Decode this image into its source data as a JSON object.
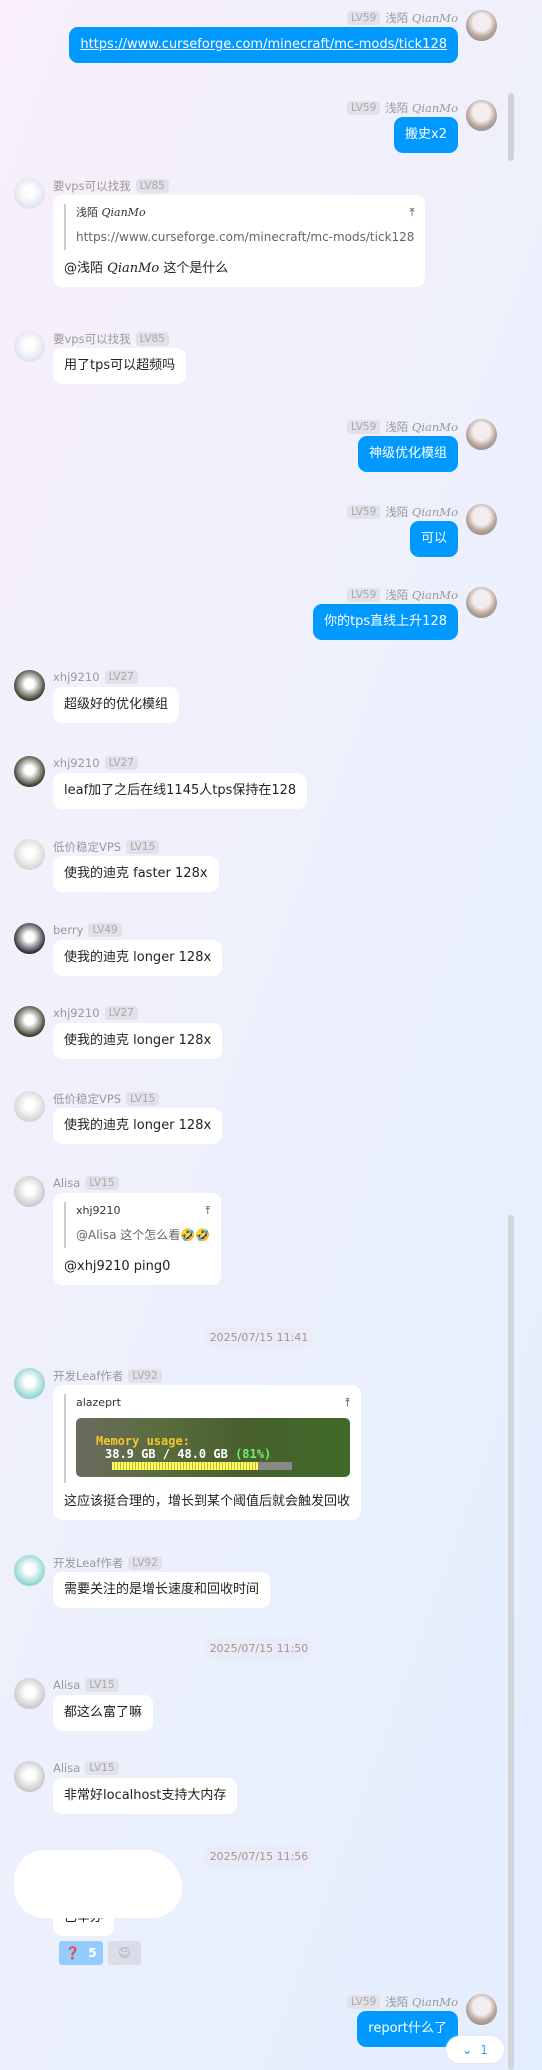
{
  "messages": [
    {
      "side": "self",
      "level": "LV59",
      "name_cn": "浅陌",
      "name_en": "QianMo",
      "text": "https://www.curseforge.com/minecraft/mc-mods/tick128",
      "link": true
    },
    {
      "side": "self",
      "level": "LV59",
      "name_cn": "浅陌",
      "name_en": "QianMo",
      "text": "搬史x2"
    },
    {
      "side": "other",
      "name": "要vps可以找我",
      "level": "LV85",
      "avatar": "#dfe3f0",
      "quote": {
        "name_cn": "浅陌",
        "name_en": "QianMo",
        "text": "https://www.curseforge.com/minecraft/mc-mods/tick128"
      },
      "mention_cn": "@浅陌",
      "mention_en": "QianMo",
      "text": "这个是什么"
    },
    {
      "side": "other",
      "name": "要vps可以找我",
      "level": "LV85",
      "avatar": "#dfe3f0",
      "text": "用了tps可以超频吗"
    },
    {
      "side": "self",
      "level": "LV59",
      "name_cn": "浅陌",
      "name_en": "QianMo",
      "text": "神级优化模组"
    },
    {
      "side": "self",
      "level": "LV59",
      "name_cn": "浅陌",
      "name_en": "QianMo",
      "text": "可以"
    },
    {
      "side": "self",
      "level": "LV59",
      "name_cn": "浅陌",
      "name_en": "QianMo",
      "text": "你的tps直线上升128"
    },
    {
      "side": "other",
      "name": "xhj9210",
      "level": "LV27",
      "avatar": "#3b3d2c",
      "text": "超级好的优化模组"
    },
    {
      "side": "other",
      "name": "xhj9210",
      "level": "LV27",
      "avatar": "#3b3d2c",
      "text": "leaf加了之后在线1145人tps保持在128"
    },
    {
      "side": "other",
      "name": "低价稳定VPS",
      "level": "LV15",
      "avatar": "#d8d4d4",
      "text": "使我的迪克 faster 128x"
    },
    {
      "side": "other",
      "name": "berry",
      "level": "LV49",
      "avatar": "#2b2b33",
      "text": "使我的迪克 longer 128x"
    },
    {
      "side": "other",
      "name": "xhj9210",
      "level": "LV27",
      "avatar": "#3b3d2c",
      "text": "使我的迪克 longer 128x"
    },
    {
      "side": "other",
      "name": "低价稳定VPS",
      "level": "LV15",
      "avatar": "#d8d4d4",
      "text": "使我的迪克 longer 128x"
    },
    {
      "side": "other",
      "name": "Alisa",
      "level": "LV15",
      "avatar": "#c9c9c9",
      "quote": {
        "name_cn": "xhj9210",
        "text": "@Alisa 这个怎么看🤣🤣"
      },
      "text": "@xhj9210 ping0"
    },
    {
      "side": "other",
      "name": "开发Leaf作者",
      "level": "LV92",
      "avatar": "#8ed3cf",
      "quote": {
        "name_cn": "alazeprt",
        "image": {
          "title": "Memory usage:",
          "used": "38.9 GB / 48.0 GB",
          "percent_label": "(81%)",
          "percent": 81
        }
      },
      "text": "这应该挺合理的，增长到某个阈值后就会触发回收"
    },
    {
      "side": "other",
      "name": "开发Leaf作者",
      "level": "LV92",
      "avatar": "#8ed3cf",
      "text": "需要关注的是增长速度和回收时间"
    },
    {
      "side": "other",
      "name": "Alisa",
      "level": "LV15",
      "avatar": "#c9c9c9",
      "text": "都这么富了嘛"
    },
    {
      "side": "other",
      "name": "Alisa",
      "level": "LV15",
      "avatar": "#c9c9c9",
      "text": "非常好localhost支持大内存"
    },
    {
      "side": "other",
      "text": "已举办",
      "hidden_sender": true
    },
    {
      "side": "self",
      "level": "LV59",
      "name_cn": "浅陌",
      "name_en": "QianMo",
      "text": "report什么了"
    }
  ],
  "timestamps": [
    "2025/07/15 11:41",
    "2025/07/15 11:50",
    "2025/07/15 11:56"
  ],
  "reactions": {
    "emoji": "❓",
    "count": "5",
    "add_icon": "add-reaction-icon"
  },
  "scroll_down": {
    "icon": "double-chevron-down-icon",
    "count": "1"
  },
  "quote_jump_icon": "jump-to-top-icon",
  "colors": {
    "self_bubble": "#0099ff",
    "accent": "#3aa0ff"
  }
}
